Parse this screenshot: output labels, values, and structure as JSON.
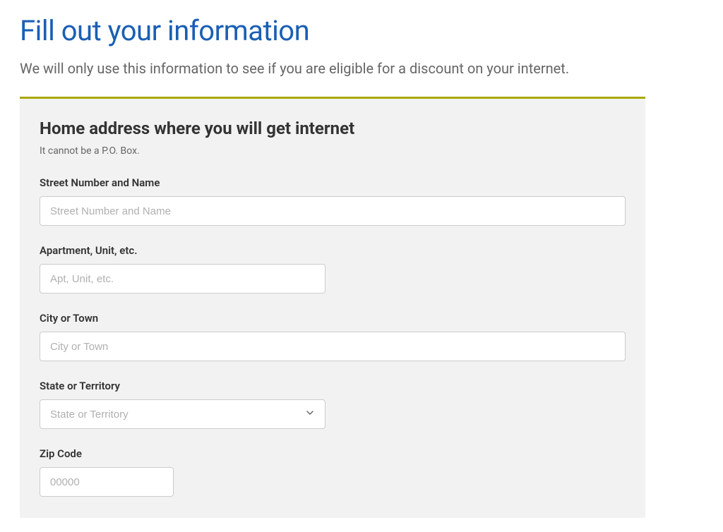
{
  "page": {
    "title": "Fill out your information",
    "subtitle": "We will only use this information to see if you are eligible for a discount on your internet."
  },
  "form": {
    "section_heading": "Home address where you will get internet",
    "section_hint": "It cannot be a P.O. Box.",
    "fields": {
      "street": {
        "label": "Street Number and Name",
        "placeholder": "Street Number and Name",
        "value": ""
      },
      "apt": {
        "label": "Apartment, Unit, etc.",
        "placeholder": "Apt, Unit, etc.",
        "value": ""
      },
      "city": {
        "label": "City or Town",
        "placeholder": "City or Town",
        "value": ""
      },
      "state": {
        "label": "State or Territory",
        "placeholder": "State or Territory",
        "value": ""
      },
      "zip": {
        "label": "Zip Code",
        "placeholder": "00000",
        "value": ""
      }
    }
  }
}
